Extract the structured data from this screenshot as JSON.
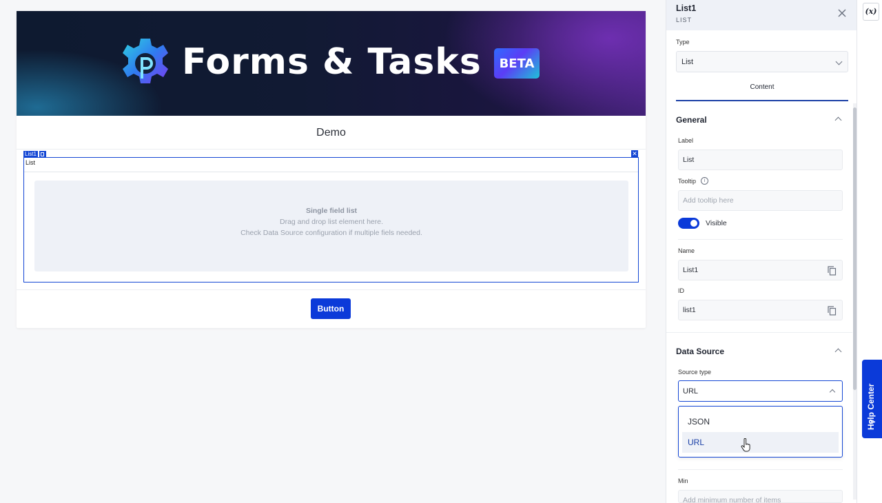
{
  "banner": {
    "title": "Forms & Tasks",
    "badge": "BETA"
  },
  "form": {
    "title": "Demo",
    "list": {
      "tag": "List1",
      "label": "List",
      "drop_title": "Single field list",
      "drop_line1": "Drag and drop list element here.",
      "drop_line2": "Check Data Source configuration if multiple fiels needed."
    },
    "button_label": "Button"
  },
  "panel": {
    "title": "List1",
    "subtitle": "LIST",
    "type_label": "Type",
    "type_value": "List",
    "tab": "Content",
    "general": {
      "title": "General",
      "label_label": "Label",
      "label_value": "List",
      "tooltip_label": "Tooltip",
      "tooltip_placeholder": "Add tooltip here",
      "visible_label": "Visible",
      "visible_on": true,
      "name_label": "Name",
      "name_value": "List1",
      "id_label": "ID",
      "id_value": "list1"
    },
    "data_source": {
      "title": "Data Source",
      "source_type_label": "Source type",
      "source_type_value": "URL",
      "options": [
        "JSON",
        "URL"
      ],
      "selected_option": "URL"
    },
    "min": {
      "label": "Min",
      "placeholder": "Add minimum number of items"
    }
  },
  "edge": {
    "variables_button": "(x)",
    "help_center": "Help Center",
    "help_icon": "?"
  },
  "colors": {
    "accent": "#0b3ad9",
    "selection_border": "#1346d4",
    "panel_header_bg": "#eef1f7"
  }
}
